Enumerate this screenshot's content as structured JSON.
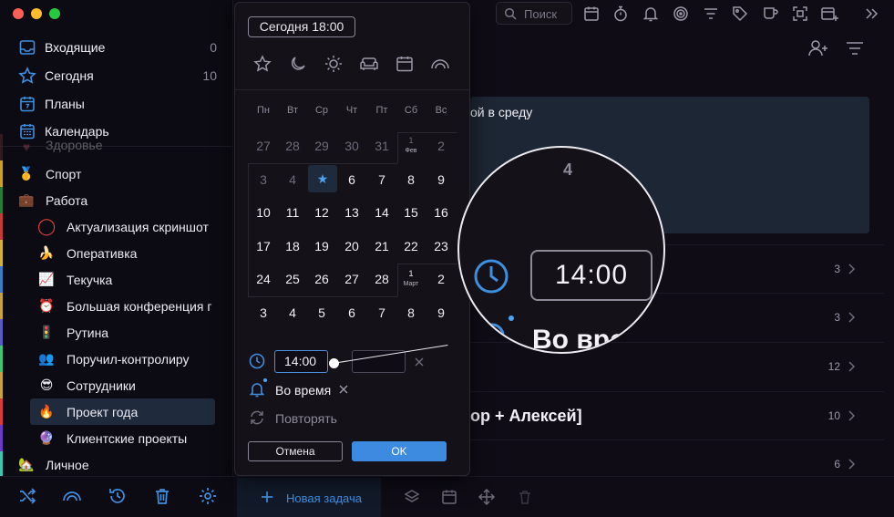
{
  "sidebar": {
    "nav": [
      {
        "label": "Входящие",
        "count": "0",
        "icon": "inbox-icon"
      },
      {
        "label": "Сегодня",
        "count": "10",
        "icon": "star-icon"
      },
      {
        "label": "Планы",
        "count": "",
        "icon": "plans-calendar-icon"
      },
      {
        "label": "Календарь",
        "count": "",
        "icon": "calendar-icon"
      }
    ],
    "tree": [
      {
        "label": "Здоровье",
        "emoji": "♥"
      },
      {
        "label": "Спорт",
        "emoji": "🥇"
      },
      {
        "label": "Работа",
        "emoji": "💼"
      },
      {
        "label": "Актуализация скриншот",
        "emoji": "◯"
      },
      {
        "label": "Оперативка",
        "emoji": "🍌"
      },
      {
        "label": "Текучка",
        "emoji": "📈"
      },
      {
        "label": "Большая конференция г",
        "emoji": "⏰"
      },
      {
        "label": "Рутина",
        "emoji": "🚦"
      },
      {
        "label": "Поручил-контролиру",
        "emoji": "👥"
      },
      {
        "label": "Сотрудники",
        "emoji": "😎"
      },
      {
        "label": "Проект года",
        "emoji": "🔥"
      },
      {
        "label": "Клиентские проекты",
        "emoji": "🔮"
      },
      {
        "label": "Личное",
        "emoji": "🏡"
      }
    ],
    "bar_colors": [
      "#7a3a3a",
      "#c9a227",
      "#2a7a3a",
      "#c73a3a",
      "#d4b13a",
      "#3a7ac7",
      "#7a7a7a",
      "#c7a33a",
      "#5a5ac7",
      "#3ac77a",
      "#d93a3a",
      "#6a3ac7",
      "#3ac7b1"
    ]
  },
  "topbar": {
    "search_placeholder": "Поиск"
  },
  "main": {
    "card_text": "ой в среду",
    "rows": [
      {
        "count": "3"
      },
      {
        "count": "3"
      },
      {
        "count": "12"
      },
      {
        "count": "10"
      },
      {
        "count": "6"
      }
    ],
    "row_title": "ор + Алексей]",
    "new_task_label": "Новая задача"
  },
  "popup": {
    "preset": "Сегодня 18:00",
    "weekdays": [
      "Пн",
      "Вт",
      "Ср",
      "Чт",
      "Пт",
      "Сб",
      "Вс"
    ],
    "weeks": [
      [
        "27",
        "28",
        "29",
        "30",
        "31",
        "1",
        "2"
      ],
      [
        "3",
        "4",
        "★",
        "6",
        "7",
        "8",
        "9"
      ],
      [
        "10",
        "11",
        "12",
        "13",
        "14",
        "15",
        "16"
      ],
      [
        "17",
        "18",
        "19",
        "20",
        "21",
        "22",
        "23"
      ],
      [
        "24",
        "25",
        "26",
        "27",
        "28",
        "1",
        "2"
      ],
      [
        "3",
        "4",
        "5",
        "6",
        "7",
        "8",
        "9"
      ]
    ],
    "month_labels": {
      "feb": "Фев",
      "mar": "Март"
    },
    "time_value": "14:00",
    "reminder_label": "Во время",
    "repeat_label": "Повторять",
    "cancel_label": "Отмена",
    "ok_label": "OK"
  },
  "loupe": {
    "time_value": "14:00",
    "reminder_label": "Во время",
    "peek_number": "4"
  },
  "colors": {
    "accent": "#3c8be0",
    "today_bg": "#1f2a3d",
    "card_bg": "#1d2634"
  }
}
